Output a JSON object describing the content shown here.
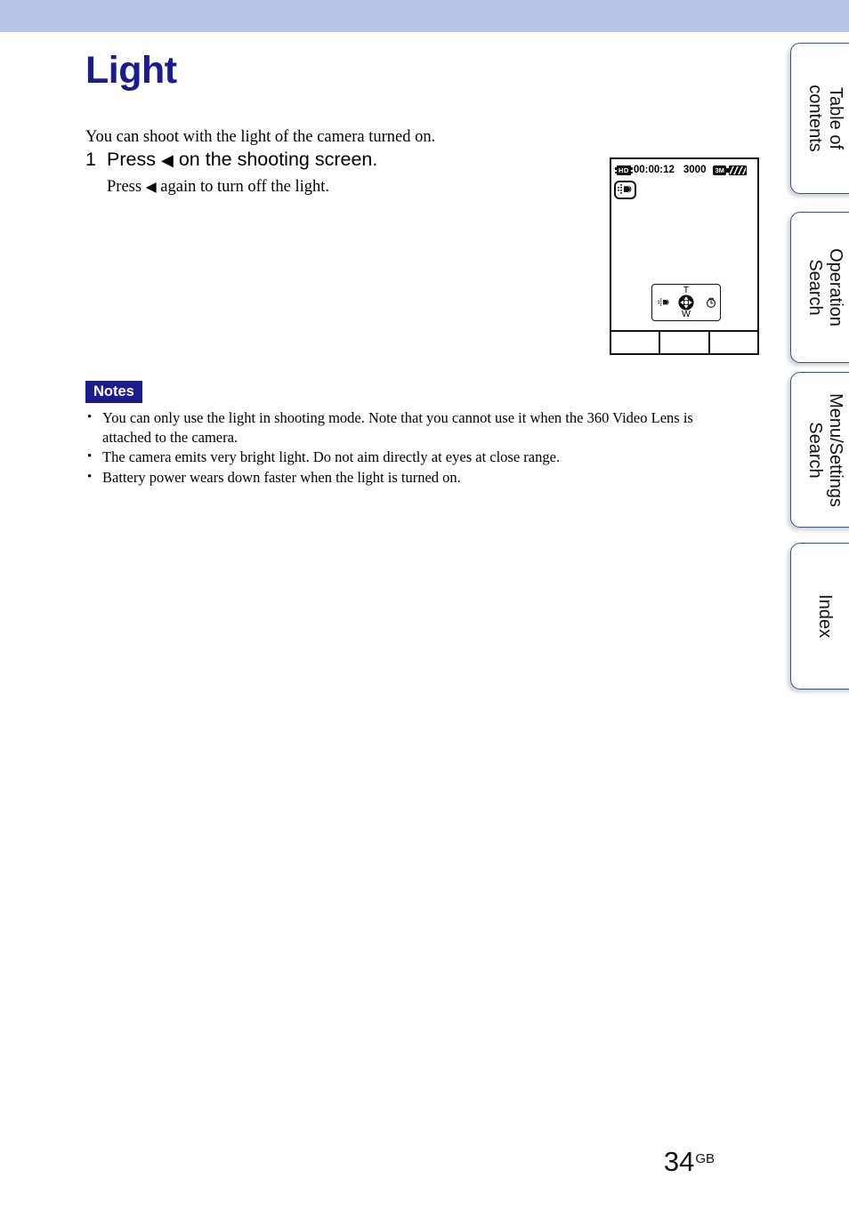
{
  "page": {
    "title": "Light",
    "intro": "You can shoot with the light of the camera turned on.",
    "number": "34",
    "number_suffix": "GB",
    "accent_color": "#1c1c8e",
    "band_color": "#b7c5ea",
    "tab_border_color": "#2f5496"
  },
  "step": {
    "number": "1",
    "heading_before": "Press",
    "heading_arrow": "◀",
    "heading_after": "on the shooting screen.",
    "sub_before": "Press",
    "sub_arrow": "◀",
    "sub_after": "again to turn off the light."
  },
  "camera_screen": {
    "quality_icon": "hd-film-icon",
    "quality_label": "HD",
    "rec_time": "00:00:12",
    "shots_remaining": "3000",
    "image_size_label": "3M",
    "battery_icon": "battery-full-icon",
    "light_indicator_icon": "light-lamp-icon",
    "control_pad": {
      "top_label": "T",
      "bottom_label": "W",
      "left_icon": "light-lamp-icon",
      "right_icon": "self-timer-icon",
      "center_icon": "four-way-disc-icon"
    },
    "softkeys": [
      "",
      "",
      ""
    ]
  },
  "notes": {
    "badge": "Notes",
    "items": [
      "You can only use the light in shooting mode. Note that you cannot use it when the 360 Video Lens is attached to the camera.",
      "The camera emits very bright light. Do not aim directly at eyes at close range.",
      "Battery power wears down faster when the light is turned on."
    ]
  },
  "side_tabs": [
    {
      "label": "Table of\ncontents",
      "line1": "Table of",
      "line2": "contents"
    },
    {
      "label": "Operation\nSearch",
      "line1": "Operation",
      "line2": "Search"
    },
    {
      "label": "Menu/Settings\nSearch",
      "line1": "Menu/Settings",
      "line2": "Search"
    },
    {
      "label": "Index",
      "line1": "Index",
      "line2": ""
    }
  ]
}
